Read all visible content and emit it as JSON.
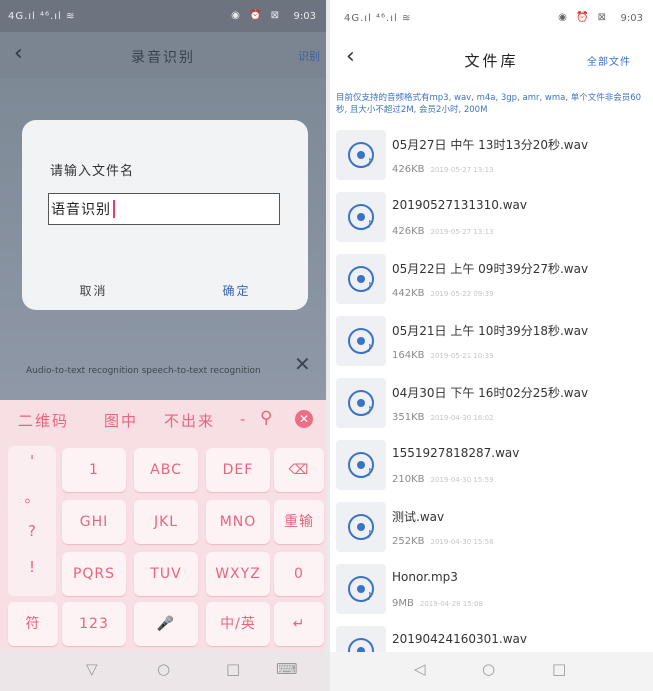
{
  "left": {
    "status": {
      "signal": "4G.ıl ⁴⁶.ıl ≋",
      "icons": "◉ ⏰ ⊠",
      "time": "9:03"
    },
    "nav": {
      "back_icon": "chevron-left-icon",
      "title": "录音识别",
      "right_label": "识别"
    },
    "background": {
      "text": "Audio-to-text recognition speech-to-text recognition",
      "close_icon": "close-icon"
    },
    "dialog": {
      "title": "请输入文件名",
      "input_value": "语音识别",
      "cancel_label": "取消",
      "ok_label": "确定"
    },
    "keyboard": {
      "candidates": [
        "二维码",
        "图中",
        "不出来",
        "-"
      ],
      "search_icon": "search-icon",
      "close_icon": "close-icon",
      "punct": [
        "'",
        "。",
        "?",
        "!"
      ],
      "keys": {
        "k1": "1",
        "abc": "ABC",
        "def": "DEF",
        "del": "⌫",
        "ghi": "GHI",
        "jkl": "JKL",
        "mno": "MNO",
        "reenter": "重输",
        "pqrs": "PQRS",
        "tuv": "TUV",
        "wxyz": "WXYZ",
        "zero": "0",
        "symbol": "符",
        "num": "123",
        "mic": "🎤",
        "lang": "中/英",
        "enter": "↵"
      }
    },
    "sysnav": {
      "back": "▽",
      "home": "○",
      "recent": "□",
      "kb": "⌨"
    }
  },
  "right": {
    "status": {
      "signal": "4G.ıl ⁴⁶.ıl ≋",
      "icons": "◉ ⏰ ⊠",
      "time": "9:03"
    },
    "nav": {
      "back_icon": "chevron-left-icon",
      "title": "文件库",
      "all_files": "全部文件"
    },
    "notice": "目前仅支持的音频格式有mp3, wav, m4a, 3gp, amr, wma, 单个文件非会员60秒, 且大小不超过2M, 会员2小时, 200M",
    "files": [
      {
        "name": "05月27日 中午 13时13分20秒.wav",
        "size": "426KB",
        "date": "2019-05-27 13:13"
      },
      {
        "name": "20190527131310.wav",
        "size": "426KB",
        "date": "2019-05-27 13:13"
      },
      {
        "name": "05月22日 上午 09时39分27秒.wav",
        "size": "442KB",
        "date": "2019-05-22 09:39"
      },
      {
        "name": "05月21日 上午 10时39分18秒.wav",
        "size": "164KB",
        "date": "2019-05-21 10:39"
      },
      {
        "name": "04月30日 下午 16时02分25秒.wav",
        "size": "351KB",
        "date": "2019-04-30 16:02"
      },
      {
        "name": "1551927818287.wav",
        "size": "210KB",
        "date": "2019-04-30 15:59"
      },
      {
        "name": "测试.wav",
        "size": "252KB",
        "date": "2019-04-30 15:58"
      },
      {
        "name": "Honor.mp3",
        "size": "9MB",
        "date": "2019-04-28 15:08"
      },
      {
        "name": "20190424160301.wav",
        "size": "",
        "date": ""
      }
    ],
    "sysnav": {
      "back": "◁",
      "home": "○",
      "recent": "□"
    }
  }
}
